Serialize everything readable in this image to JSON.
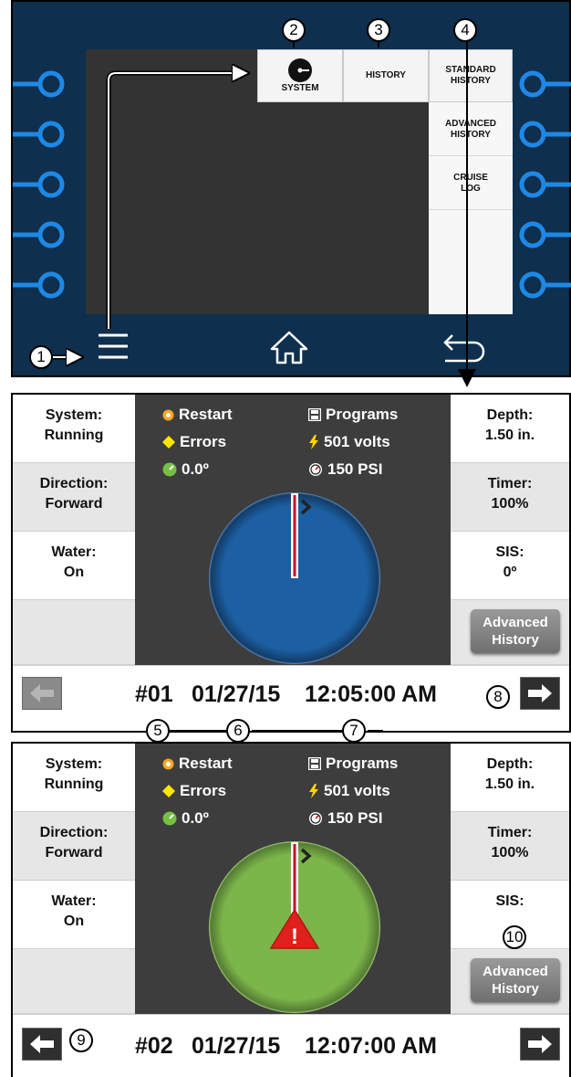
{
  "menu": {
    "system_label": "SYSTEM",
    "history_label": "HISTORY",
    "standard_history_line1": "STANDARD",
    "standard_history_line2": "HISTORY",
    "advanced_history_line1": "ADVANCED",
    "advanced_history_line2": "HISTORY",
    "cruise_log_line1": "CRUISE",
    "cruise_log_line2": "LOG"
  },
  "callouts": [
    "1",
    "2",
    "3",
    "4",
    "5",
    "6",
    "7",
    "8",
    "9",
    "10"
  ],
  "screen1": {
    "left": [
      {
        "label": "System:",
        "value": "Running"
      },
      {
        "label": "Direction:",
        "value": "Forward"
      },
      {
        "label": "Water:",
        "value": "On"
      }
    ],
    "right": [
      {
        "label": "Depth:",
        "value": "1.50 in."
      },
      {
        "label": "Timer:",
        "value": "100%"
      },
      {
        "label": "SIS:",
        "value": "0º"
      }
    ],
    "stats": {
      "restart": "Restart",
      "errors": "Errors",
      "angle": "0.0º",
      "programs": "Programs",
      "volts": "501 volts",
      "pressure": "150 PSI"
    },
    "advanced_button": {
      "line1": "Advanced",
      "line2": "History"
    },
    "record": "#01",
    "date": "01/27/15",
    "time": "12:05:00 AM",
    "pie_color": "#1c5fa3"
  },
  "screen2": {
    "left": [
      {
        "label": "System:",
        "value": "Running"
      },
      {
        "label": "Direction:",
        "value": "Forward"
      },
      {
        "label": "Water:",
        "value": "On"
      }
    ],
    "right": [
      {
        "label": "Depth:",
        "value": "1.50 in."
      },
      {
        "label": "Timer:",
        "value": "100%"
      },
      {
        "label": "SIS:",
        "value": ""
      }
    ],
    "stats": {
      "restart": "Restart",
      "errors": "Errors",
      "angle": "0.0º",
      "programs": "Programs",
      "volts": "501 volts",
      "pressure": "150 PSI"
    },
    "warning_mark": "!",
    "advanced_button": {
      "line1": "Advanced",
      "line2": "History"
    },
    "record": "#02",
    "date": "01/27/15",
    "time": "12:07:00 AM",
    "pie_color": "#7cb64a"
  },
  "icons": {
    "restart": "restart-icon",
    "errors": "errors-diamond-icon",
    "angle": "angle-gauge-icon",
    "programs": "programs-disk-icon",
    "volts": "lightning-icon",
    "pressure": "pressure-gauge-icon"
  },
  "colors": {
    "panel": "#0e2f4e",
    "terminal": "#1e88e5",
    "restart": "#f5a623",
    "errors": "#ffe600",
    "angle": "#76c043",
    "volts": "#ffd400",
    "warning": "#e0201b"
  }
}
